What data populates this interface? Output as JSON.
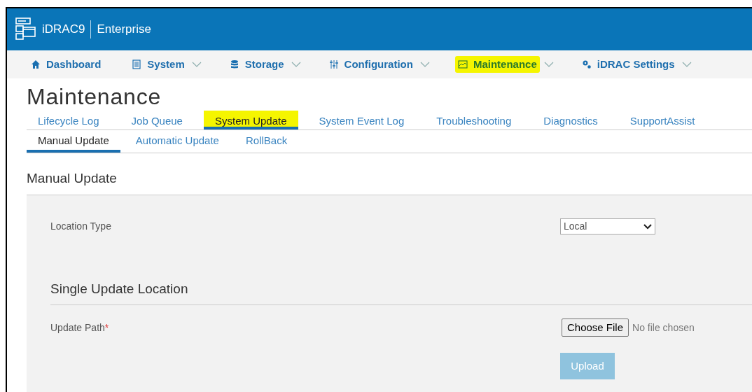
{
  "header": {
    "product": "iDRAC9",
    "edition": "Enterprise"
  },
  "nav": [
    {
      "label": "Dashboard",
      "dropdown": false,
      "highlighted": false
    },
    {
      "label": "System",
      "dropdown": true,
      "highlighted": false
    },
    {
      "label": "Storage",
      "dropdown": true,
      "highlighted": false
    },
    {
      "label": "Configuration",
      "dropdown": true,
      "highlighted": false
    },
    {
      "label": "Maintenance",
      "dropdown": true,
      "highlighted": true
    },
    {
      "label": "iDRAC Settings",
      "dropdown": true,
      "highlighted": false
    }
  ],
  "page_title": "Maintenance",
  "tabs": [
    {
      "label": "Lifecycle Log",
      "selected": false,
      "highlighted": false
    },
    {
      "label": "Job Queue",
      "selected": false,
      "highlighted": false
    },
    {
      "label": "System Update",
      "selected": true,
      "highlighted": true
    },
    {
      "label": "System Event Log",
      "selected": false,
      "highlighted": false
    },
    {
      "label": "Troubleshooting",
      "selected": false,
      "highlighted": false
    },
    {
      "label": "Diagnostics",
      "selected": false,
      "highlighted": false
    },
    {
      "label": "SupportAssist",
      "selected": false,
      "highlighted": false
    }
  ],
  "subtabs": [
    {
      "label": "Manual Update",
      "selected": true
    },
    {
      "label": "Automatic Update",
      "selected": false
    },
    {
      "label": "RollBack",
      "selected": false
    }
  ],
  "section_title": "Manual Update",
  "location_type": {
    "label": "Location Type",
    "value": "Local"
  },
  "subsection_title": "Single Update Location",
  "update_path": {
    "label": "Update Path",
    "required_mark": "*",
    "button": "Choose File",
    "status": "No file chosen"
  },
  "upload": {
    "label": "Upload",
    "disabled": true
  }
}
